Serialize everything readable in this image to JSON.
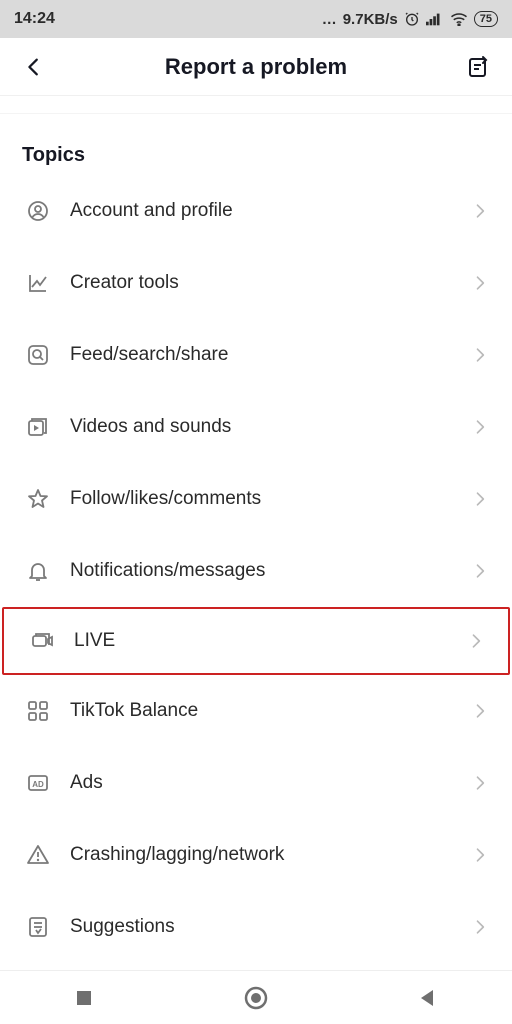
{
  "status": {
    "time": "14:24",
    "net_speed": "9.7KB/s",
    "battery": "75"
  },
  "header": {
    "title": "Report a problem"
  },
  "section": {
    "title": "Topics"
  },
  "topics": [
    {
      "icon": "profile-icon",
      "label": "Account and profile"
    },
    {
      "icon": "chart-icon",
      "label": "Creator tools"
    },
    {
      "icon": "search-icon",
      "label": "Feed/search/share"
    },
    {
      "icon": "video-icon",
      "label": "Videos and sounds"
    },
    {
      "icon": "star-icon",
      "label": "Follow/likes/comments"
    },
    {
      "icon": "bell-icon",
      "label": "Notifications/messages"
    },
    {
      "icon": "live-icon",
      "label": "LIVE",
      "highlight": true
    },
    {
      "icon": "apps-icon",
      "label": "TikTok Balance"
    },
    {
      "icon": "ad-icon",
      "label": "Ads"
    },
    {
      "icon": "warning-icon",
      "label": "Crashing/lagging/network"
    },
    {
      "icon": "doc-icon",
      "label": "Suggestions"
    }
  ]
}
